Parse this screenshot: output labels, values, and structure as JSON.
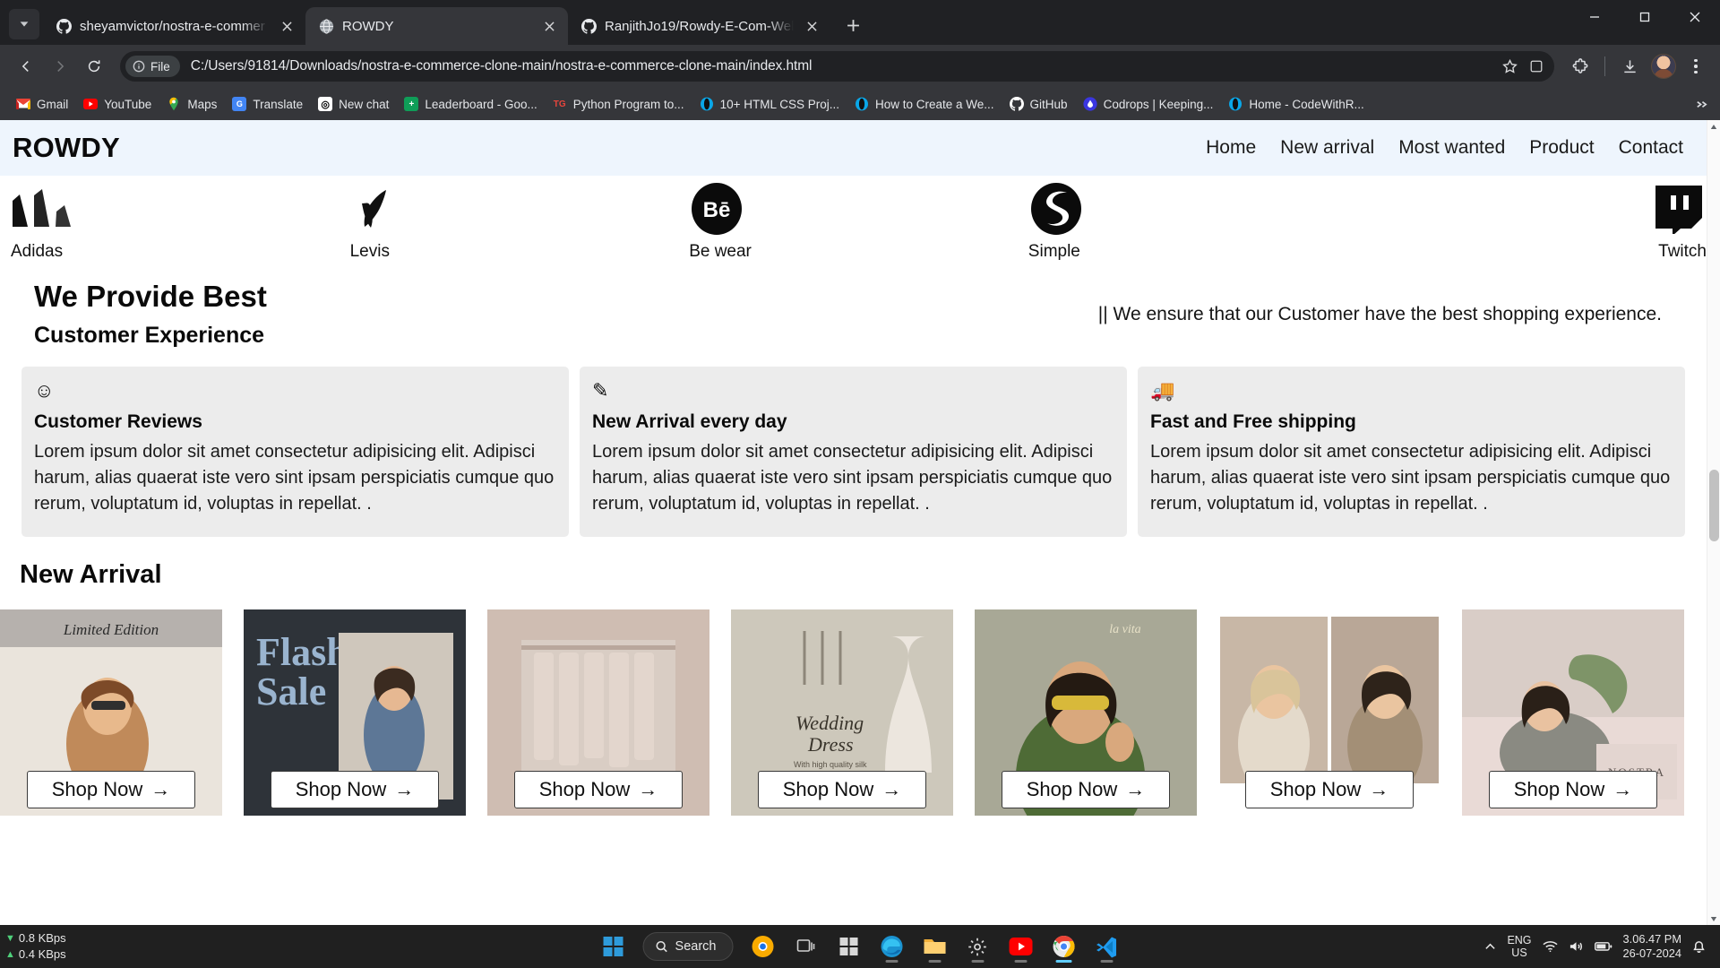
{
  "browser": {
    "tabs": [
      {
        "title": "sheyamvictor/nostra-e-commer",
        "favicon": "github-icon",
        "active": false
      },
      {
        "title": "ROWDY",
        "favicon": "globe-icon",
        "active": true
      },
      {
        "title": "RanjithJo19/Rowdy-E-Com-Web",
        "favicon": "github-icon",
        "active": false
      }
    ],
    "new_tab_label": "+",
    "window_controls": {
      "minimize": "minimize-icon",
      "maximize": "maximize-icon",
      "close": "close-icon"
    },
    "toolbar": {
      "back": "back-arrow-icon",
      "forward": "forward-arrow-icon",
      "reload": "reload-icon",
      "file_chip_label": "File",
      "url": "C:/Users/91814/Downloads/nostra-e-commerce-clone-main/nostra-e-commerce-clone-main/index.html",
      "bookmark_star": "star-icon",
      "extensions": "puzzle-icon",
      "downloads": "download-icon",
      "profile": "avatar",
      "menu": "three-dot-menu-icon"
    },
    "bookmarks": [
      {
        "label": "Gmail",
        "icon": "gmail-icon",
        "color": "#ea4335"
      },
      {
        "label": "YouTube",
        "icon": "youtube-icon",
        "color": "#ff0000"
      },
      {
        "label": "Maps",
        "icon": "maps-icon",
        "color": "#34a853"
      },
      {
        "label": "Translate",
        "icon": "translate-icon",
        "color": "#4285f4"
      },
      {
        "label": "New chat",
        "icon": "openai-icon",
        "color": "#ffffff"
      },
      {
        "label": "Leaderboard - Goo...",
        "icon": "sheets-icon",
        "color": "#0f9d58"
      },
      {
        "label": "Python Program to...",
        "icon": "tg-icon",
        "color": "#e8453c"
      },
      {
        "label": "10+ HTML CSS Proj...",
        "icon": "opera-icon",
        "color": "#00b0ff"
      },
      {
        "label": "How to Create a We...",
        "icon": "opera-icon",
        "color": "#00b0ff"
      },
      {
        "label": "GitHub",
        "icon": "github-icon",
        "color": "#ffffff"
      },
      {
        "label": "Codrops | Keeping...",
        "icon": "codrops-icon",
        "color": "#3a36e0"
      },
      {
        "label": "Home - CodeWithR...",
        "icon": "opera-icon",
        "color": "#00b0ff"
      }
    ],
    "bookmarks_overflow": "chevron-right-icon"
  },
  "site": {
    "brand": "ROWDY",
    "nav": [
      {
        "label": "Home"
      },
      {
        "label": "New arrival"
      },
      {
        "label": "Most wanted"
      },
      {
        "label": "Product"
      },
      {
        "label": "Contact"
      }
    ],
    "logos": [
      {
        "name": "Adidas",
        "mark": "adidas-logo"
      },
      {
        "name": "Levis",
        "mark": "levis-logo"
      },
      {
        "name": "Be wear",
        "mark": "behance-logo"
      },
      {
        "name": "Simple",
        "mark": "simple-logo"
      },
      {
        "name": "Twitch",
        "mark": "twitch-logo"
      }
    ],
    "provide": {
      "heading": "We Provide Best",
      "subheading": "Customer Experience",
      "note": "|| We ensure that our Customer have the best shopping experience."
    },
    "cards": [
      {
        "icon": "smiley-icon",
        "glyph": "☺",
        "title": "Customer Reviews",
        "text": "Lorem ipsum dolor sit amet consectetur adipisicing elit. Adipisci harum, alias quaerat iste vero sint ipsam perspiciatis cumque quo rerum, voluptatum id, voluptas in repellat. ."
      },
      {
        "icon": "pencil-square-icon",
        "glyph": "✎",
        "title": "New Arrival every day",
        "text": "Lorem ipsum dolor sit amet consectetur adipisicing elit. Adipisci harum, alias quaerat iste vero sint ipsam perspiciatis cumque quo rerum, voluptatum id, voluptas in repellat. ."
      },
      {
        "icon": "truck-icon",
        "glyph": "🚚",
        "title": "Fast and Free shipping",
        "text": "Lorem ipsum dolor sit amet consectetur adipisicing elit. Adipisci harum, alias quaerat iste vero sint ipsam perspiciatis cumque quo rerum, voluptatum id, voluptas in repellat. ."
      }
    ],
    "new_arrival_heading": "New Arrival",
    "products": [
      {
        "shop_label": "Shop Now",
        "caption": "Limited Edition"
      },
      {
        "shop_label": "Shop Now",
        "caption": "Flash Sale"
      },
      {
        "shop_label": "Shop Now",
        "caption": ""
      },
      {
        "shop_label": "Shop Now",
        "caption": "Wedding Dress"
      },
      {
        "shop_label": "Shop Now",
        "caption": ""
      },
      {
        "shop_label": "Shop Now",
        "caption": ""
      },
      {
        "shop_label": "Shop Now",
        "caption": "NOSTRA"
      }
    ],
    "shop_arrow": "→"
  },
  "taskbar": {
    "network": {
      "down": "0.8 KBps",
      "up": "0.4 KBps"
    },
    "start": "windows-start-icon",
    "search_label": "Search",
    "apps": [
      {
        "name": "chrome-canary-icon"
      },
      {
        "name": "task-view-icon"
      },
      {
        "name": "microsoft-store-icon"
      },
      {
        "name": "edge-icon"
      },
      {
        "name": "file-explorer-icon"
      },
      {
        "name": "settings-icon"
      },
      {
        "name": "youtube-icon"
      },
      {
        "name": "chrome-icon"
      },
      {
        "name": "vscode-icon"
      }
    ],
    "tray": {
      "overflow": "chevron-up-icon",
      "language_line1": "ENG",
      "language_line2": "US",
      "wifi": "wifi-icon",
      "volume": "speaker-icon",
      "battery": "battery-icon",
      "time": "3.06.47 PM",
      "date": "26-07-2024",
      "notifications": "bell-icon"
    }
  }
}
